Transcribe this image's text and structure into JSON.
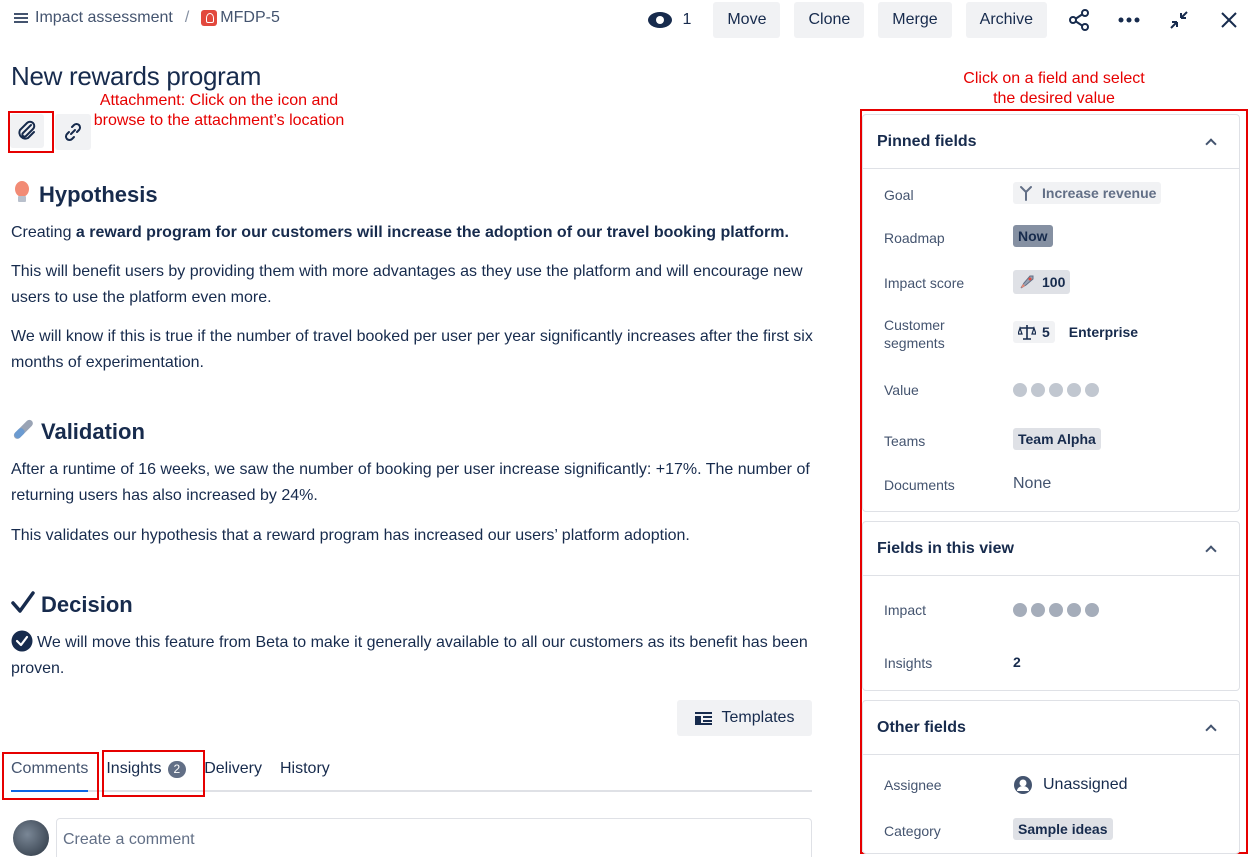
{
  "breadcrumb": {
    "project": "Impact assessment",
    "separator": "/",
    "issue_key": "MFDP-5"
  },
  "toolbar": {
    "watch_count": "1",
    "move": "Move",
    "clone": "Clone",
    "merge": "Merge",
    "archive": "Archive"
  },
  "issue": {
    "title": "New rewards program"
  },
  "annotations": {
    "attachment": "Attachment: Click on the icon and browse to the attachment’s location",
    "fields": "Click on a field and select the desired value"
  },
  "hypothesis": {
    "heading": "Hypothesis",
    "lead_plain": "Creating ",
    "lead_bold": "a reward program for our customers will increase the adoption of our travel booking platform.",
    "p2": "This will benefit users by providing them with more advantages as they use the platform and will encourage new users to use the platform even more.",
    "p3": "We will know if this is true if the number of travel booked per user per year significantly increases after the first six months of experimentation."
  },
  "validation": {
    "heading": "Validation",
    "p1": "After a runtime of 16 weeks, we saw the number of booking per user increase significantly: +17%. The number of returning users has also increased by 24%.",
    "p2": "This validates our hypothesis that a reward program has increased our users’ platform adoption."
  },
  "decision": {
    "heading": "Decision",
    "p1": "We will move this feature from Beta to make it generally available to all our customers as its benefit has been proven."
  },
  "templates_label": "Templates",
  "tabs": [
    {
      "label": "Comments"
    },
    {
      "label": "Insights",
      "badge": "2"
    },
    {
      "label": "Delivery"
    },
    {
      "label": "History"
    }
  ],
  "comment_placeholder": "Create a comment",
  "pinned": {
    "heading": "Pinned fields",
    "goal_label": "Goal",
    "goal_value": "Increase revenue",
    "roadmap_label": "Roadmap",
    "roadmap_value": "Now",
    "impact_label": "Impact score",
    "impact_value": "100",
    "segments_label": "Customer segments",
    "segments_count": "5",
    "segments_value": "Enterprise",
    "value_label": "Value",
    "value_rating": 0,
    "teams_label": "Teams",
    "teams_value": "Team Alpha",
    "documents_label": "Documents",
    "documents_value": "None"
  },
  "view_fields": {
    "heading": "Fields in this view",
    "impact_label": "Impact",
    "impact_rating": 0,
    "insights_label": "Insights",
    "insights_value": "2"
  },
  "other": {
    "heading": "Other fields",
    "assignee_label": "Assignee",
    "assignee_value": "Unassigned",
    "category_label": "Category",
    "category_value": "Sample ideas"
  },
  "colors": {
    "annotation": "#e60000",
    "text": "#172b4d",
    "button_bg": "#f1f2f4"
  }
}
